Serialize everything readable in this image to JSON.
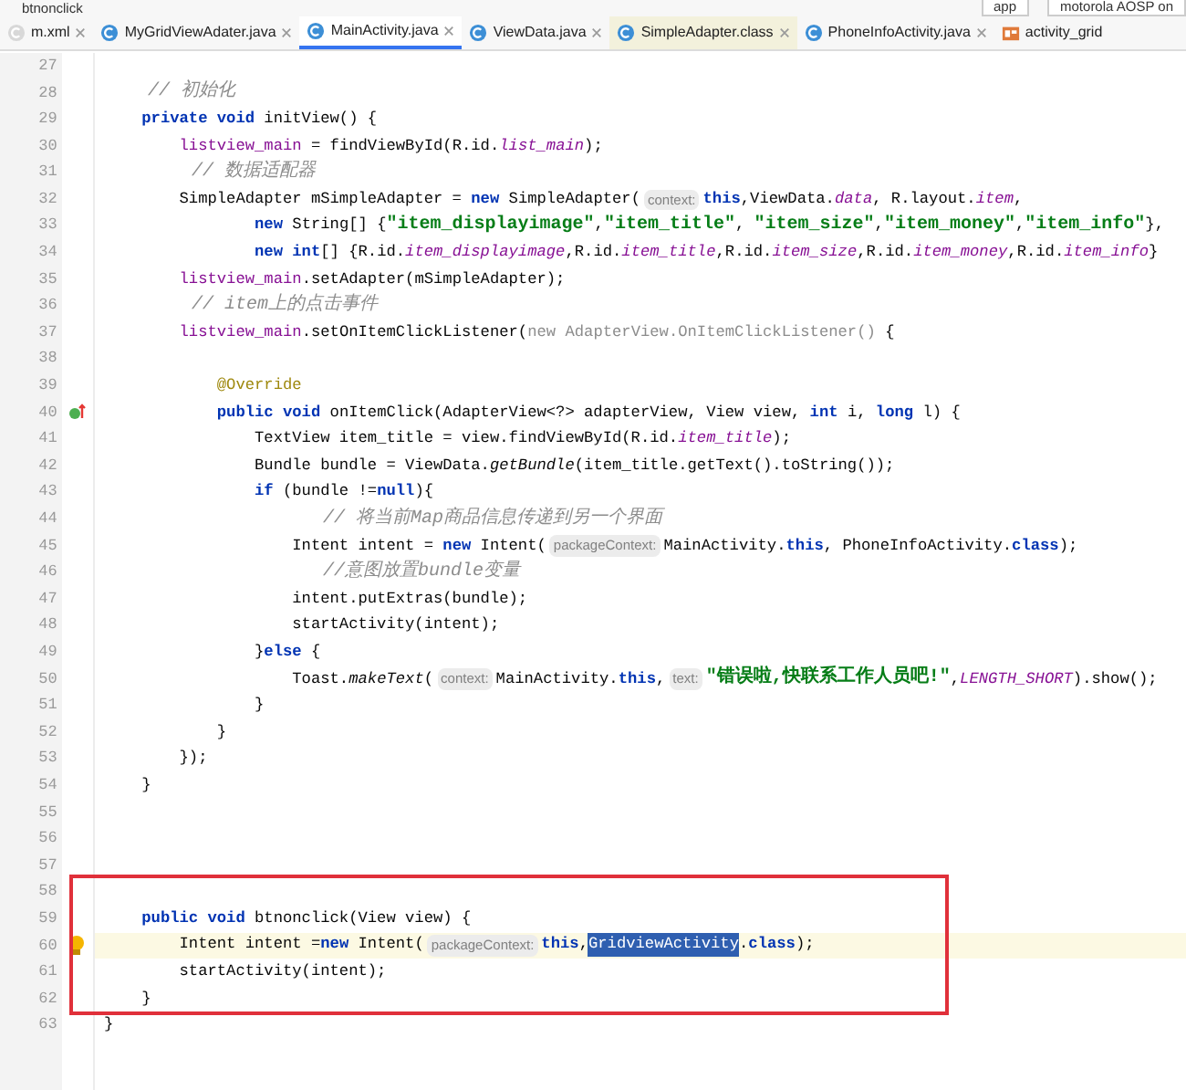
{
  "toolbar": {
    "breadcrumb": "btnonclick",
    "run_config": "app",
    "device": "motorola AOSP on"
  },
  "tabs": [
    {
      "label": "m.xml",
      "kind": "xml",
      "selected": false
    },
    {
      "label": "MyGridViewAdater.java",
      "kind": "java",
      "selected": false
    },
    {
      "label": "MainActivity.java",
      "kind": "java",
      "selected": true
    },
    {
      "label": "ViewData.java",
      "kind": "java",
      "selected": false
    },
    {
      "label": "SimpleAdapter.class",
      "kind": "class",
      "selected": false
    },
    {
      "label": "PhoneInfoActivity.java",
      "kind": "java",
      "selected": false
    },
    {
      "label": "activity_grid",
      "kind": "layout",
      "selected": false
    }
  ],
  "lines": [
    {
      "number": "27"
    },
    {
      "number": "28",
      "tokens": [
        {
          "text": "    // 初始化",
          "kind": "comment"
        }
      ]
    },
    {
      "number": "29",
      "tokens": [
        {
          "text": "    private void",
          "kind": "keyword"
        },
        {
          "text": " initView() {",
          "kind": "plain"
        }
      ]
    },
    {
      "number": "30",
      "tokens": [
        {
          "text": "        listview_main",
          "kind": "member"
        },
        {
          "text": " = findViewById(R.id.",
          "kind": "plain"
        },
        {
          "text": "list_main",
          "kind": "static"
        },
        {
          "text": ");",
          "kind": "plain"
        }
      ]
    },
    {
      "number": "31",
      "tokens": [
        {
          "text": "        // 数据适配器",
          "kind": "comment"
        }
      ]
    },
    {
      "number": "32",
      "tokens": [
        {
          "text": "        SimpleAdapter mSimpleAdapter = ",
          "kind": "plain"
        },
        {
          "text": "new",
          "kind": "keyword"
        },
        {
          "text": " SimpleAdapter(",
          "kind": "plain"
        },
        {
          "text": "context:",
          "kind": "hint"
        },
        {
          "text": "this",
          "kind": "keyword"
        },
        {
          "text": ",ViewData.",
          "kind": "plain"
        },
        {
          "text": "data",
          "kind": "static"
        },
        {
          "text": ", R.layout.",
          "kind": "plain"
        },
        {
          "text": "item",
          "kind": "static"
        },
        {
          "text": ",",
          "kind": "plain"
        }
      ]
    },
    {
      "number": "33",
      "tokens": [
        {
          "text": "                new",
          "kind": "keyword"
        },
        {
          "text": " String[] {",
          "kind": "plain"
        },
        {
          "text": "\"item_displayimage\"",
          "kind": "string"
        },
        {
          "text": ",",
          "kind": "plain"
        },
        {
          "text": "\"item_title\"",
          "kind": "string"
        },
        {
          "text": ", ",
          "kind": "plain"
        },
        {
          "text": "\"item_size\"",
          "kind": "string"
        },
        {
          "text": ",",
          "kind": "plain"
        },
        {
          "text": "\"item_money\"",
          "kind": "string"
        },
        {
          "text": ",",
          "kind": "plain"
        },
        {
          "text": "\"item_info\"",
          "kind": "string"
        },
        {
          "text": "},",
          "kind": "plain"
        }
      ]
    },
    {
      "number": "34",
      "tokens": [
        {
          "text": "                new int",
          "kind": "keyword"
        },
        {
          "text": "[] {R.id.",
          "kind": "plain"
        },
        {
          "text": "item_displayimage",
          "kind": "static"
        },
        {
          "text": ",R.id.",
          "kind": "plain"
        },
        {
          "text": "item_title",
          "kind": "static"
        },
        {
          "text": ",R.id.",
          "kind": "plain"
        },
        {
          "text": "item_size",
          "kind": "static"
        },
        {
          "text": ",R.id.",
          "kind": "plain"
        },
        {
          "text": "item_money",
          "kind": "static"
        },
        {
          "text": ",R.id.",
          "kind": "plain"
        },
        {
          "text": "item_info",
          "kind": "static"
        },
        {
          "text": "}",
          "kind": "plain"
        }
      ]
    },
    {
      "number": "35",
      "tokens": [
        {
          "text": "        listview_main",
          "kind": "member"
        },
        {
          "text": ".setAdapter(mSimpleAdapter);",
          "kind": "plain"
        }
      ]
    },
    {
      "number": "36",
      "tokens": [
        {
          "text": "        // item上的点击事件",
          "kind": "comment"
        }
      ]
    },
    {
      "number": "37",
      "tokens": [
        {
          "text": "        listview_main",
          "kind": "member"
        },
        {
          "text": ".setOnItemClickListener(",
          "kind": "plain"
        },
        {
          "text": "new AdapterView.OnItemClickListener()",
          "kind": "dim"
        },
        {
          "text": " {",
          "kind": "plain"
        }
      ]
    },
    {
      "number": "38"
    },
    {
      "number": "39",
      "tokens": [
        {
          "text": "            @Override",
          "kind": "annotation"
        }
      ]
    },
    {
      "number": "40",
      "override": true,
      "tokens": [
        {
          "text": "            public void",
          "kind": "keyword"
        },
        {
          "text": " onItemClick(AdapterView<?> adapterView, View view, ",
          "kind": "plain"
        },
        {
          "text": "int",
          "kind": "keyword"
        },
        {
          "text": " i, ",
          "kind": "plain"
        },
        {
          "text": "long",
          "kind": "keyword"
        },
        {
          "text": " l) {",
          "kind": "plain"
        }
      ]
    },
    {
      "number": "41",
      "tokens": [
        {
          "text": "                TextView item_title = view.findViewById(R.id.",
          "kind": "plain"
        },
        {
          "text": "item_title",
          "kind": "static"
        },
        {
          "text": ");",
          "kind": "plain"
        }
      ]
    },
    {
      "number": "42",
      "tokens": [
        {
          "text": "                Bundle bundle = ViewData.",
          "kind": "plain"
        },
        {
          "text": "getBundle",
          "kind": "italic"
        },
        {
          "text": "(item_title.getText().toString());",
          "kind": "plain"
        }
      ]
    },
    {
      "number": "43",
      "tokens": [
        {
          "text": "                if",
          "kind": "keyword"
        },
        {
          "text": " (bundle !=",
          "kind": "plain"
        },
        {
          "text": "null",
          "kind": "keyword"
        },
        {
          "text": "){",
          "kind": "plain"
        }
      ]
    },
    {
      "number": "44",
      "tokens": [
        {
          "text": "                    // 将当前Map商品信息传递到另一个界面",
          "kind": "comment"
        }
      ]
    },
    {
      "number": "45",
      "tokens": [
        {
          "text": "                    Intent intent = ",
          "kind": "plain"
        },
        {
          "text": "new",
          "kind": "keyword"
        },
        {
          "text": " Intent(",
          "kind": "plain"
        },
        {
          "text": "packageContext:",
          "kind": "hint"
        },
        {
          "text": "MainActivity.",
          "kind": "plain"
        },
        {
          "text": "this",
          "kind": "keyword"
        },
        {
          "text": ", PhoneInfoActivity.",
          "kind": "plain"
        },
        {
          "text": "class",
          "kind": "keyword"
        },
        {
          "text": ");",
          "kind": "plain"
        }
      ]
    },
    {
      "number": "46",
      "tokens": [
        {
          "text": "                    //意图放置bundle变量",
          "kind": "comment"
        }
      ]
    },
    {
      "number": "47",
      "tokens": [
        {
          "text": "                    intent.putExtras(bundle);",
          "kind": "plain"
        }
      ]
    },
    {
      "number": "48",
      "tokens": [
        {
          "text": "                    startActivity(intent);",
          "kind": "plain"
        }
      ]
    },
    {
      "number": "49",
      "tokens": [
        {
          "text": "                }",
          "kind": "plain"
        },
        {
          "text": "else",
          "kind": "keyword"
        },
        {
          "text": " {",
          "kind": "plain"
        }
      ]
    },
    {
      "number": "50",
      "tokens": [
        {
          "text": "                    Toast.",
          "kind": "plain"
        },
        {
          "text": "makeText",
          "kind": "italic"
        },
        {
          "text": "(",
          "kind": "plain"
        },
        {
          "text": "context:",
          "kind": "hint"
        },
        {
          "text": "MainActivity.",
          "kind": "plain"
        },
        {
          "text": "this",
          "kind": "keyword"
        },
        {
          "text": ",",
          "kind": "plain"
        },
        {
          "text": "text:",
          "kind": "hint"
        },
        {
          "text": "\"错误啦,快联系工作人员吧!\"",
          "kind": "string"
        },
        {
          "text": ",",
          "kind": "plain"
        },
        {
          "text": "LENGTH_SHORT",
          "kind": "static"
        },
        {
          "text": ").show();",
          "kind": "plain"
        }
      ]
    },
    {
      "number": "51",
      "tokens": [
        {
          "text": "                }",
          "kind": "plain"
        }
      ]
    },
    {
      "number": "52",
      "tokens": [
        {
          "text": "            }",
          "kind": "plain"
        }
      ]
    },
    {
      "number": "53",
      "tokens": [
        {
          "text": "        });",
          "kind": "plain"
        }
      ]
    },
    {
      "number": "54",
      "tokens": [
        {
          "text": "    }",
          "kind": "plain"
        }
      ]
    },
    {
      "number": "55"
    },
    {
      "number": "56"
    },
    {
      "number": "57"
    },
    {
      "number": "58",
      "boxed": true
    },
    {
      "number": "59",
      "boxed": true,
      "tokens": [
        {
          "text": "    public void",
          "kind": "keyword"
        },
        {
          "text": " btnonclick(View view) {",
          "kind": "plain"
        }
      ]
    },
    {
      "number": "60",
      "boxed": true,
      "current": true,
      "intention": true,
      "tokens": [
        {
          "text": "        Intent intent =",
          "kind": "plain"
        },
        {
          "text": "new",
          "kind": "keyword"
        },
        {
          "text": " Intent(",
          "kind": "plain"
        },
        {
          "text": "packageContext:",
          "kind": "hint"
        },
        {
          "text": "this",
          "kind": "keyword"
        },
        {
          "text": ",",
          "kind": "plain"
        },
        {
          "text": "GridviewActivity",
          "kind": "selected"
        },
        {
          "text": ".",
          "kind": "plain"
        },
        {
          "text": "class",
          "kind": "keyword"
        },
        {
          "text": ");",
          "kind": "plain"
        }
      ]
    },
    {
      "number": "61",
      "boxed": true,
      "tokens": [
        {
          "text": "        startActivity(intent);",
          "kind": "plain"
        }
      ]
    },
    {
      "number": "62",
      "boxed": true,
      "tokens": [
        {
          "text": "    }",
          "kind": "plain"
        }
      ]
    },
    {
      "number": "63",
      "tokens": [
        {
          "text": "}",
          "kind": "plain"
        }
      ]
    }
  ]
}
